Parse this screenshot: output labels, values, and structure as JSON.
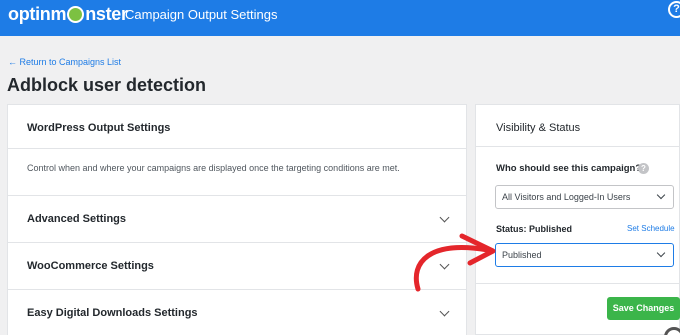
{
  "header": {
    "logo_text_1": "optinm",
    "logo_text_2": "nster",
    "title": "Campaign Output Settings",
    "help_icon": "?"
  },
  "breadcrumb": {
    "back_label": "← Return to Campaigns List"
  },
  "page_title": "Adblock user detection",
  "left_panel": {
    "sections": [
      {
        "title": "WordPress Output Settings",
        "description": "Control when and where your campaigns are displayed once the targeting conditions are met."
      },
      {
        "title": "Advanced Settings"
      },
      {
        "title": "WooCommerce Settings"
      },
      {
        "title": "Easy Digital Downloads Settings"
      }
    ]
  },
  "right_panel": {
    "title": "Visibility & Status",
    "who_label": "Who should see this campaign?",
    "who_help_icon": "?",
    "who_value": "All Visitors and Logged-In Users",
    "status_label": "Status: Published",
    "schedule_link": "Set Schedule",
    "status_value": "Published",
    "save_button": "Save Changes"
  },
  "colors": {
    "brand_blue": "#1e7ce6",
    "save_green": "#3bb54a",
    "arrow_red": "#e4262b"
  },
  "icons": [
    "logo-monster-icon",
    "help-icon",
    "chevron-down-icon",
    "question-icon",
    "annotation-arrow"
  ]
}
